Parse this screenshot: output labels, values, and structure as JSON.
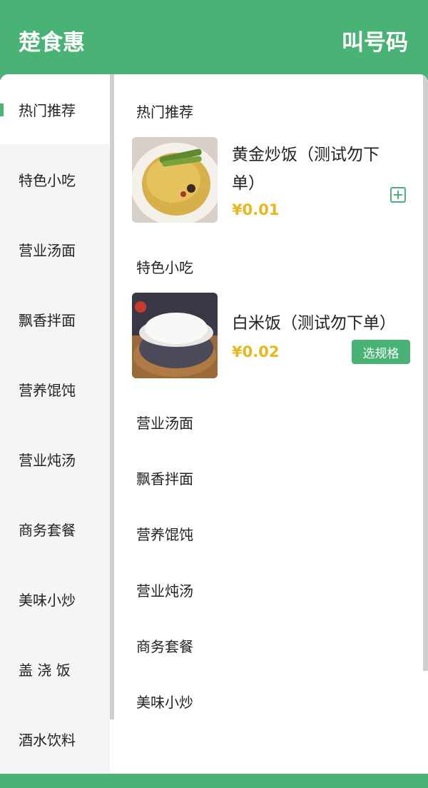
{
  "header": {
    "brand": "楚食惠",
    "call_number": "叫号码"
  },
  "sidebar": {
    "items": [
      {
        "label": "热门推荐"
      },
      {
        "label": "特色小吃"
      },
      {
        "label": "营业汤面"
      },
      {
        "label": "飘香拌面"
      },
      {
        "label": "营养馄饨"
      },
      {
        "label": "营业炖汤"
      },
      {
        "label": "商务套餐"
      },
      {
        "label": "美味小炒"
      },
      {
        "label": "盖 浇 饭"
      },
      {
        "label": "酒水饮料"
      }
    ]
  },
  "content": {
    "sections": [
      {
        "title": "热门推荐"
      },
      {
        "title": "特色小吃"
      },
      {
        "title": "营业汤面"
      },
      {
        "title": "飘香拌面"
      },
      {
        "title": "营养馄饨"
      },
      {
        "title": "营业炖汤"
      },
      {
        "title": "商务套餐"
      },
      {
        "title": "美味小炒"
      }
    ],
    "dishes": [
      {
        "name": "黄金炒饭（测试勿下单）",
        "price": "¥0.01",
        "action": "add"
      },
      {
        "name": "白米饭（测试勿下单）",
        "price": "¥0.02",
        "action_label": "选规格"
      }
    ]
  },
  "colors": {
    "brand_green": "#48b374",
    "price_yellow": "#e8b81a"
  }
}
